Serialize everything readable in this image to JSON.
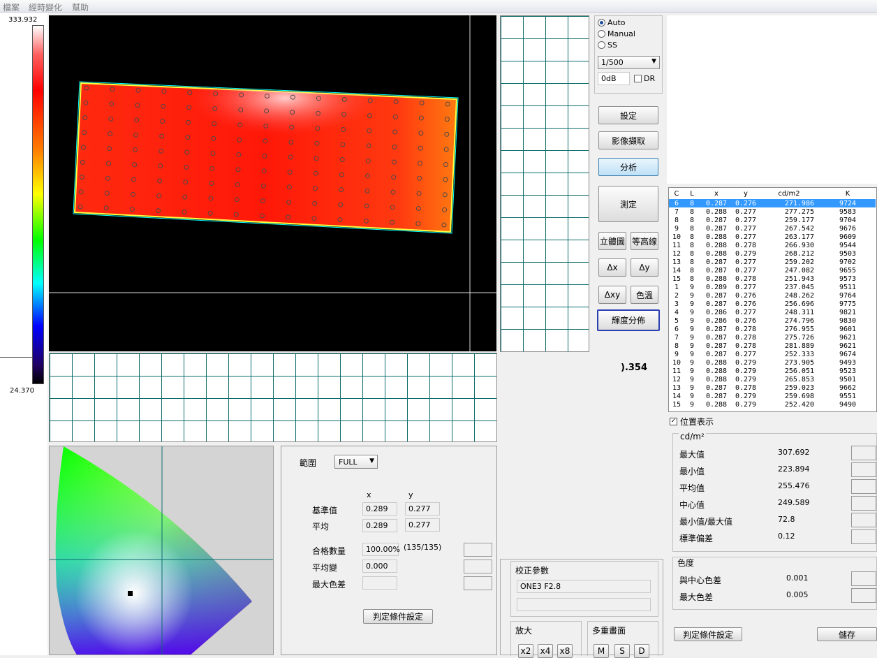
{
  "menu": [
    "檔案",
    "經時變化",
    "幫助"
  ],
  "scale": {
    "max": "333.932",
    "min": "24.370"
  },
  "exposure": {
    "modes": [
      "Auto",
      "Manual",
      "SS"
    ],
    "selected_mode": "Auto",
    "shutter": "1/500",
    "gain": "0dB",
    "dr_label": "DR"
  },
  "buttons": {
    "settings": "設定",
    "capture": "影像擷取",
    "analyze": "分析",
    "measure": "測定",
    "view3d": "立體圖",
    "contour": "等高線",
    "dx": "Δx",
    "dy": "Δy",
    "dxy": "Δxy",
    "color_temp": "色溫",
    "lum_dist": "輝度分佈"
  },
  "partial_value": ").354",
  "table": {
    "headers": [
      "C",
      "L",
      "x",
      "y",
      "cd/m2",
      "K"
    ],
    "rows": [
      [
        "6",
        "8",
        "0.287",
        "0.276",
        "271.986",
        "9724"
      ],
      [
        "7",
        "8",
        "0.288",
        "0.277",
        "277.275",
        "9583"
      ],
      [
        "8",
        "8",
        "0.287",
        "0.277",
        "259.177",
        "9704"
      ],
      [
        "9",
        "8",
        "0.287",
        "0.277",
        "267.542",
        "9676"
      ],
      [
        "10",
        "8",
        "0.288",
        "0.277",
        "263.177",
        "9609"
      ],
      [
        "11",
        "8",
        "0.288",
        "0.278",
        "266.930",
        "9544"
      ],
      [
        "12",
        "8",
        "0.288",
        "0.279",
        "268.212",
        "9503"
      ],
      [
        "13",
        "8",
        "0.287",
        "0.277",
        "259.202",
        "9702"
      ],
      [
        "14",
        "8",
        "0.287",
        "0.277",
        "247.082",
        "9655"
      ],
      [
        "15",
        "8",
        "0.288",
        "0.278",
        "251.943",
        "9573"
      ],
      [
        "1",
        "9",
        "0.289",
        "0.277",
        "237.045",
        "9511"
      ],
      [
        "2",
        "9",
        "0.287",
        "0.276",
        "248.262",
        "9764"
      ],
      [
        "3",
        "9",
        "0.287",
        "0.276",
        "256.696",
        "9775"
      ],
      [
        "4",
        "9",
        "0.286",
        "0.277",
        "248.311",
        "9821"
      ],
      [
        "5",
        "9",
        "0.286",
        "0.276",
        "274.796",
        "9830"
      ],
      [
        "6",
        "9",
        "0.287",
        "0.278",
        "276.955",
        "9601"
      ],
      [
        "7",
        "9",
        "0.287",
        "0.278",
        "275.726",
        "9621"
      ],
      [
        "8",
        "9",
        "0.287",
        "0.278",
        "281.889",
        "9621"
      ],
      [
        "9",
        "9",
        "0.287",
        "0.277",
        "252.333",
        "9674"
      ],
      [
        "10",
        "9",
        "0.288",
        "0.279",
        "273.905",
        "9493"
      ],
      [
        "11",
        "9",
        "0.288",
        "0.279",
        "256.051",
        "9523"
      ],
      [
        "12",
        "9",
        "0.288",
        "0.279",
        "265.853",
        "9501"
      ],
      [
        "13",
        "9",
        "0.287",
        "0.278",
        "259.023",
        "9662"
      ],
      [
        "14",
        "9",
        "0.287",
        "0.279",
        "259.698",
        "9551"
      ],
      [
        "15",
        "9",
        "0.288",
        "0.279",
        "252.420",
        "9490"
      ]
    ]
  },
  "stats": {
    "position_display": "位置表示",
    "unit": "cd/m²",
    "rows": [
      {
        "label": "最大值",
        "value": "307.692"
      },
      {
        "label": "最小值",
        "value": "223.894"
      },
      {
        "label": "平均值",
        "value": "255.476"
      },
      {
        "label": "中心值",
        "value": "249.589"
      },
      {
        "label": "最小值/最大值",
        "value": "72.8"
      },
      {
        "label": "標準偏差",
        "value": "0.12"
      }
    ],
    "color_title": "色度",
    "color_rows": [
      {
        "label": "與中心色差",
        "value": "0.001"
      },
      {
        "label": "最大色差",
        "value": "0.005"
      }
    ],
    "judge_button": "判定條件設定",
    "save_button": "儲存"
  },
  "judge": {
    "range_label": "範圍",
    "range_value": "FULL",
    "x_header": "x",
    "y_header": "y",
    "ref_label": "基準值",
    "ref_x": "0.289",
    "ref_y": "0.277",
    "avg_label": "平均",
    "avg_x": "0.289",
    "avg_y": "0.277",
    "pass_label": "合格數量",
    "pass_value": "100.00%",
    "pass_count": "(135/135)",
    "avg_change_label": "平均變",
    "avg_change_value": "0.000",
    "max_diff_label": "最大色差",
    "judge_button": "判定條件設定"
  },
  "calib": {
    "title": "校正參數",
    "value": "ONE3 F2.8",
    "zoom_title": "放大",
    "zoom_buttons": [
      "x2",
      "x4",
      "x8"
    ],
    "multi_title": "多重畫面",
    "multi_buttons": [
      "M",
      "S",
      "D"
    ]
  }
}
